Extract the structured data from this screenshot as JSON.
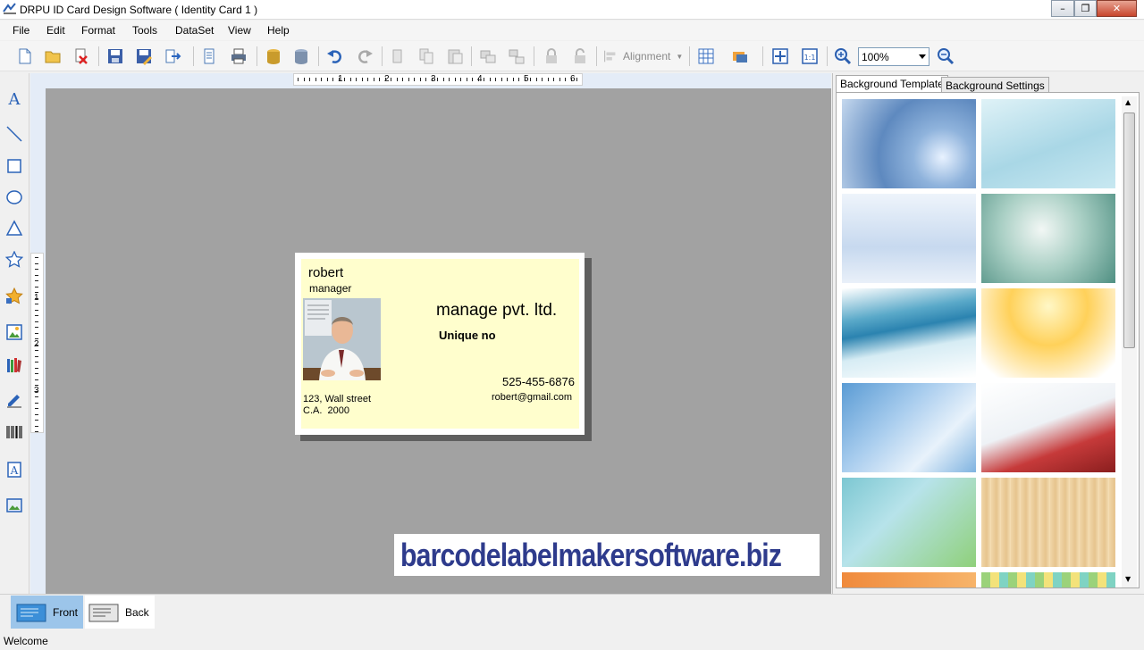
{
  "window": {
    "title": "DRPU ID Card Design Software ( Identity Card 1 )"
  },
  "menu": [
    "File",
    "Edit",
    "Format",
    "Tools",
    "DataSet",
    "View",
    "Help"
  ],
  "toolbar": {
    "alignment_label": "Alignment",
    "zoom_value": "100%",
    "icons": [
      "new-icon",
      "open-icon",
      "close-file-icon",
      "save-icon",
      "save-as-icon",
      "export-icon",
      "print-preview-icon",
      "print-icon",
      "database-icon",
      "database-list-icon",
      "undo-icon",
      "redo-icon",
      "cut-icon",
      "copy-icon",
      "paste-icon",
      "group-icon",
      "ungroup-icon",
      "lock-icon",
      "unlock-icon",
      "alignment-icon",
      "grid-icon",
      "image-icon",
      "fit-to-window-icon",
      "actual-size-icon",
      "zoom-in-icon",
      "zoom-out-icon"
    ]
  },
  "palette": [
    "text-tool-icon",
    "line-tool-icon",
    "rectangle-tool-icon",
    "ellipse-tool-icon",
    "triangle-tool-icon",
    "star-tool-icon",
    "symbol-tool-icon",
    "picture-tool-icon",
    "library-tool-icon",
    "signature-tool-icon",
    "barcode-tool-icon",
    "watermark-tool-icon",
    "image-library-icon"
  ],
  "rulers": {
    "horizontal_numbers": [
      "1",
      "2",
      "3",
      "4",
      "5",
      "6"
    ],
    "vertical_numbers": [
      "1",
      "2",
      "3"
    ]
  },
  "card": {
    "name": "robert",
    "designation": "manager",
    "company": "manage pvt. ltd.",
    "unique_label": "Unique no",
    "phone": "525-455-6876",
    "email": "robert@gmail.com",
    "address_line1": "123, Wall street",
    "address_line2": "C.A.  2000"
  },
  "watermark": "barcodelabelmakersoftware.biz",
  "right_panel": {
    "tabs": [
      "Background Template",
      "Background Settings"
    ],
    "active_tab": "Background Template"
  },
  "bottom_tabs": {
    "front": "Front",
    "back": "Back"
  },
  "status": "Welcome",
  "colors": {
    "card_background": "#fffecd",
    "canvas": "#a2a2a2",
    "watermark_text": "#2e3b8c",
    "front_tab_active": "#9cc5ea"
  }
}
